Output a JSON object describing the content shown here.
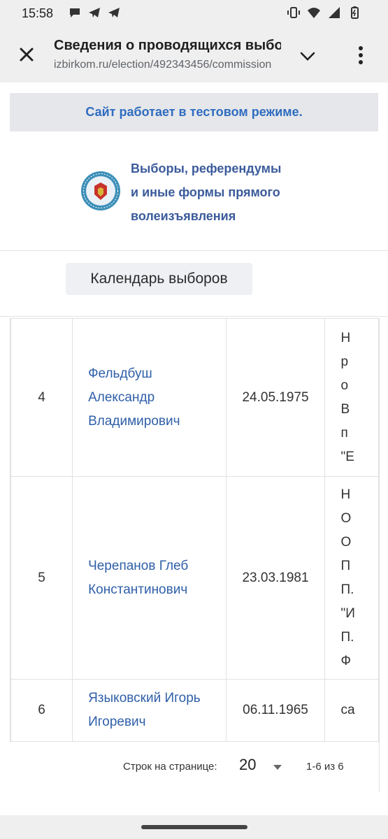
{
  "status_bar": {
    "time": "15:58",
    "left_icons": [
      "messages-icon",
      "telegram-icon",
      "telegram-icon"
    ],
    "right_icons": [
      "vibrate-icon",
      "wifi-icon",
      "signal-icon",
      "battery-icon"
    ]
  },
  "browser": {
    "title": "Сведения о проводящихся выборах",
    "url": "izbirkom.ru/election/492343456/commission"
  },
  "banner": {
    "text": "Сайт работает в тестовом режиме."
  },
  "header": {
    "org_name_lines": [
      "Выборы, референдумы",
      "и иные формы прямого",
      "волеизъявления"
    ]
  },
  "calendar_button": {
    "label": "Календарь выборов"
  },
  "table": {
    "rows": [
      {
        "num": "4",
        "name": "Фельдбуш Александр Владимирович",
        "date": "24.05.1975",
        "desc_fragments": [
          "Н",
          "р",
          "о",
          "В",
          "п",
          "\"Е"
        ]
      },
      {
        "num": "5",
        "name": "Черепанов Глеб Константинович",
        "date": "23.03.1981",
        "desc_fragments": [
          "Н",
          "О",
          "О",
          "П",
          "П.",
          "\"И",
          "П.",
          "Ф"
        ]
      },
      {
        "num": "6",
        "name": "Языковский Игорь Игоревич",
        "date": "06.11.1965",
        "desc_fragments": [
          "са"
        ]
      }
    ]
  },
  "pagination": {
    "rows_per_page_label": "Строк на странице:",
    "rows_per_page_value": "20",
    "range_text": "1-6 из 6"
  }
}
